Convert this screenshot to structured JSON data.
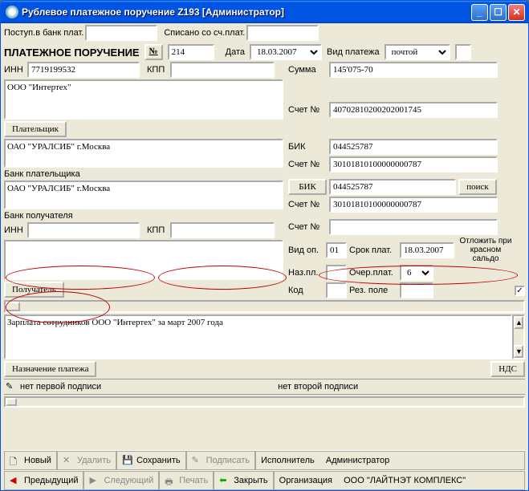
{
  "window": {
    "title": "Рублевое платежное поручение Z193 [Администратор]"
  },
  "top": {
    "recv_bank_lbl": "Поступ.в банк плат.",
    "recv_bank_val": "",
    "debit_lbl": "Списано со сч.плат.",
    "debit_val": ""
  },
  "header": {
    "title": "ПЛАТЕЖНОЕ ПОРУЧЕНИЕ",
    "num_lbl": "№",
    "num_val": "214",
    "date_lbl": "Дата",
    "date_val": "18.03.2007",
    "paytype_lbl": "Вид платежа",
    "paytype_val": "почтой"
  },
  "payer": {
    "inn_lbl": "ИНН",
    "inn_val": "7719199532",
    "kpp_lbl": "КПП",
    "kpp_val": "",
    "name": "ООО \"Интертех\"",
    "tab": "Плательщик",
    "sum_lbl": "Сумма",
    "sum_val": "145'075-70",
    "acct_lbl": "Счет №",
    "acct_val": "40702810200202001745"
  },
  "payer_bank": {
    "name": "ОАО \"УРАЛСИБ\" г.Москва",
    "caption": "Банк плательщика",
    "bik_lbl": "БИК",
    "bik_val": "044525787",
    "acct_lbl": "Счет №",
    "acct_val": "30101810100000000787"
  },
  "recip_bank": {
    "name": "ОАО \"УРАЛСИБ\" г.Москва",
    "caption": "Банк получателя",
    "bik_btn": "БИК",
    "bik_val": "044525787",
    "search_btn": "поиск",
    "acct_lbl": "Счет №",
    "acct_val": "30101810100000000787"
  },
  "recip": {
    "inn_lbl": "ИНН",
    "inn_val": "",
    "kpp_lbl": "КПП",
    "kpp_val": "",
    "name": "",
    "tab": "Получатель",
    "acct_lbl": "Счет №",
    "acct_val": "",
    "vidop_lbl": "Вид оп.",
    "vidop_val": "01",
    "srok_lbl": "Срок плат.",
    "srok_val": "18.03.2007",
    "nazpl_lbl": "Наз.пл.",
    "nazpl_val": "",
    "ocher_lbl": "Очер.плат.",
    "ocher_val": "6",
    "kod_lbl": "Код",
    "kod_val": "",
    "rez_lbl": "Рез. поле",
    "rez_val": "",
    "defer_lbl": "Отложить при красном сальдо",
    "defer_checked": "✓"
  },
  "purpose": {
    "text": "Зарплата сотрудников ООО \"Интертех\" за март 2007 года",
    "tab": "Назначение платежа",
    "nds_tab": "НДС"
  },
  "sig": {
    "no_first": "нет первой подписи",
    "no_second": "нет второй подписи"
  },
  "footer": {
    "new": "Новый",
    "delete": "Удалить",
    "save": "Сохранить",
    "sign": "Подписать",
    "prev": "Предыдущий",
    "next": "Следующий",
    "print": "Печать",
    "close": "Закрыть",
    "exec_lbl": "Исполнитель",
    "exec_val": "Администратор",
    "org_lbl": "Организация",
    "org_val": "ООО \"ЛАЙТНЭТ КОМПЛЕКС\""
  }
}
